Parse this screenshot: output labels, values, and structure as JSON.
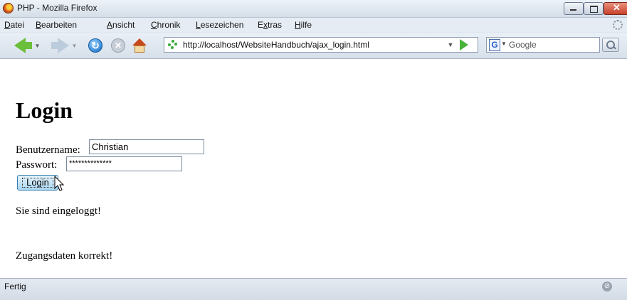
{
  "window": {
    "title": "PHP - Mozilla Firefox",
    "close_glyph": "✕"
  },
  "menu": {
    "items": [
      {
        "u": "D",
        "rest": "atei"
      },
      {
        "u": "B",
        "rest": "earbeiten"
      },
      {
        "u": "A",
        "rest": "nsicht"
      },
      {
        "u": "C",
        "rest": "hronik"
      },
      {
        "u": "L",
        "rest": "esezeichen"
      },
      {
        "pre": "E",
        "u": "x",
        "rest": "tras"
      },
      {
        "u": "H",
        "rest": "ilfe"
      }
    ]
  },
  "toolbar": {
    "url": "http://localhost/WebsiteHandbuch/ajax_login.html",
    "search_engine_glyph": "G",
    "search_placeholder": "Google",
    "drop_glyph": "▼"
  },
  "page": {
    "heading": "Login",
    "username_label": "Benutzername:",
    "username_value": "Christian",
    "password_label": "Passwort:",
    "password_value": "**************",
    "login_button": "Login",
    "message_1": "Sie sind eingeloggt!",
    "message_2": "Zugangsdaten korrekt!"
  },
  "status": {
    "text": "Fertig"
  },
  "icons": [
    "firefox-logo-icon",
    "back-arrow-icon",
    "forward-arrow-icon",
    "reload-icon",
    "stop-icon",
    "home-icon",
    "site-icon",
    "go-arrow-icon",
    "search-icon",
    "throbber-icon",
    "mouse-cursor-icon"
  ]
}
